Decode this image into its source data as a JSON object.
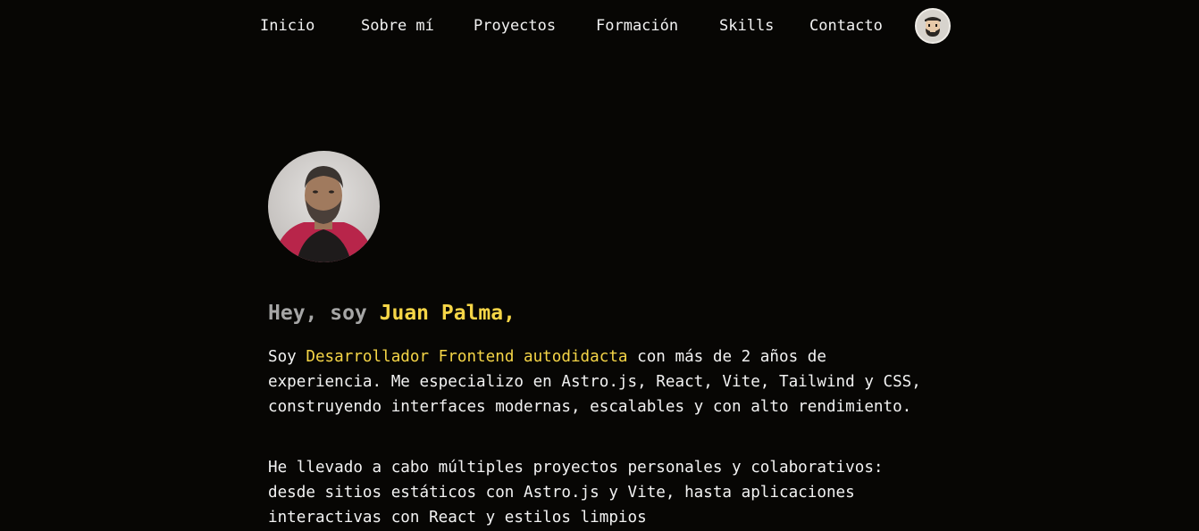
{
  "nav": {
    "items": [
      {
        "label": "Inicio"
      },
      {
        "label": "Sobre mí"
      },
      {
        "label": "Proyectos"
      },
      {
        "label": "Formación"
      },
      {
        "label": "Skills"
      },
      {
        "label": "Contacto"
      }
    ]
  },
  "hero": {
    "greeting_lead": "Hey, soy",
    "greeting_name": "Juan Palma,",
    "p1_start": "Soy",
    "p1_highlight": "Desarrollador Frontend autodidacta",
    "p1_rest": "con más de 2 años de experiencia. Me especializo en Astro.js, React, Vite, Tailwind y CSS, construyendo interfaces modernas, escalables y con alto rendimiento.",
    "p2": "He llevado a cabo múltiples proyectos personales y colaborativos: desde sitios estáticos con Astro.js y Vite, hasta aplicaciones interactivas con React y estilos limpios"
  },
  "icons": {
    "nav_avatar": "cartoon-face-avatar-icon",
    "profile_photo": "profile-photo-avatar"
  },
  "colors": {
    "background": "#070604",
    "text": "#f2f2f2",
    "accent": "#f5d547",
    "muted": "#a6a6a6"
  }
}
